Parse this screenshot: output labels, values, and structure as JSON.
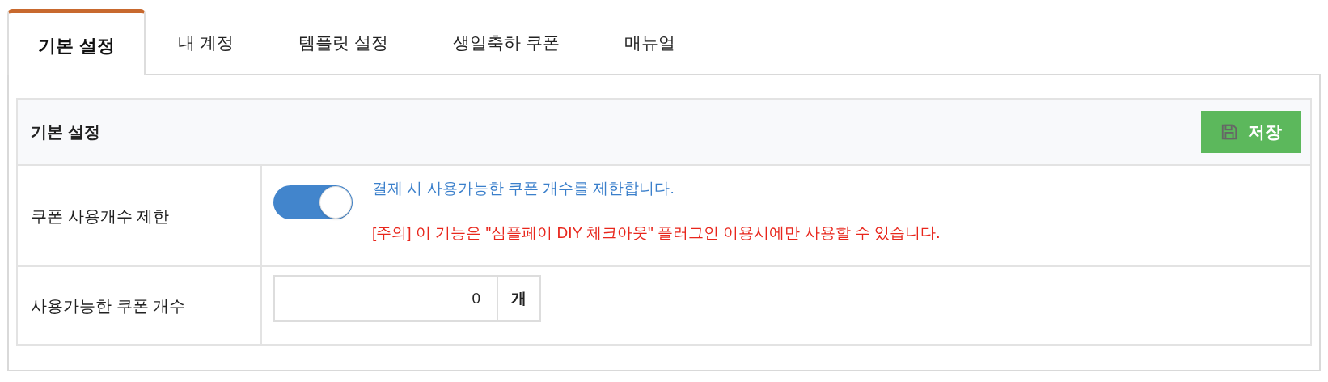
{
  "tabs": [
    {
      "label": "기본 설정",
      "selected": true
    },
    {
      "label": "내 계정",
      "selected": false
    },
    {
      "label": "템플릿 설정",
      "selected": false
    },
    {
      "label": "생일축하 쿠폰",
      "selected": false
    },
    {
      "label": "매뉴얼",
      "selected": false
    }
  ],
  "panel": {
    "title": "기본 설정",
    "save_button": "저장"
  },
  "rows": [
    {
      "kind": "toggle",
      "label": "쿠폰 사용개수 제한",
      "on": true,
      "description": "결제 시 사용가능한 쿠폰 개수를 제한합니다.",
      "warning": "[주의] 이 기능은 \"심플페이 DIY 체크아웃\" 플러그인 이용시에만 사용할 수 있습니다."
    },
    {
      "kind": "number",
      "label": "사용가능한 쿠폰 개수",
      "value": "0",
      "unit": "개"
    }
  ]
}
